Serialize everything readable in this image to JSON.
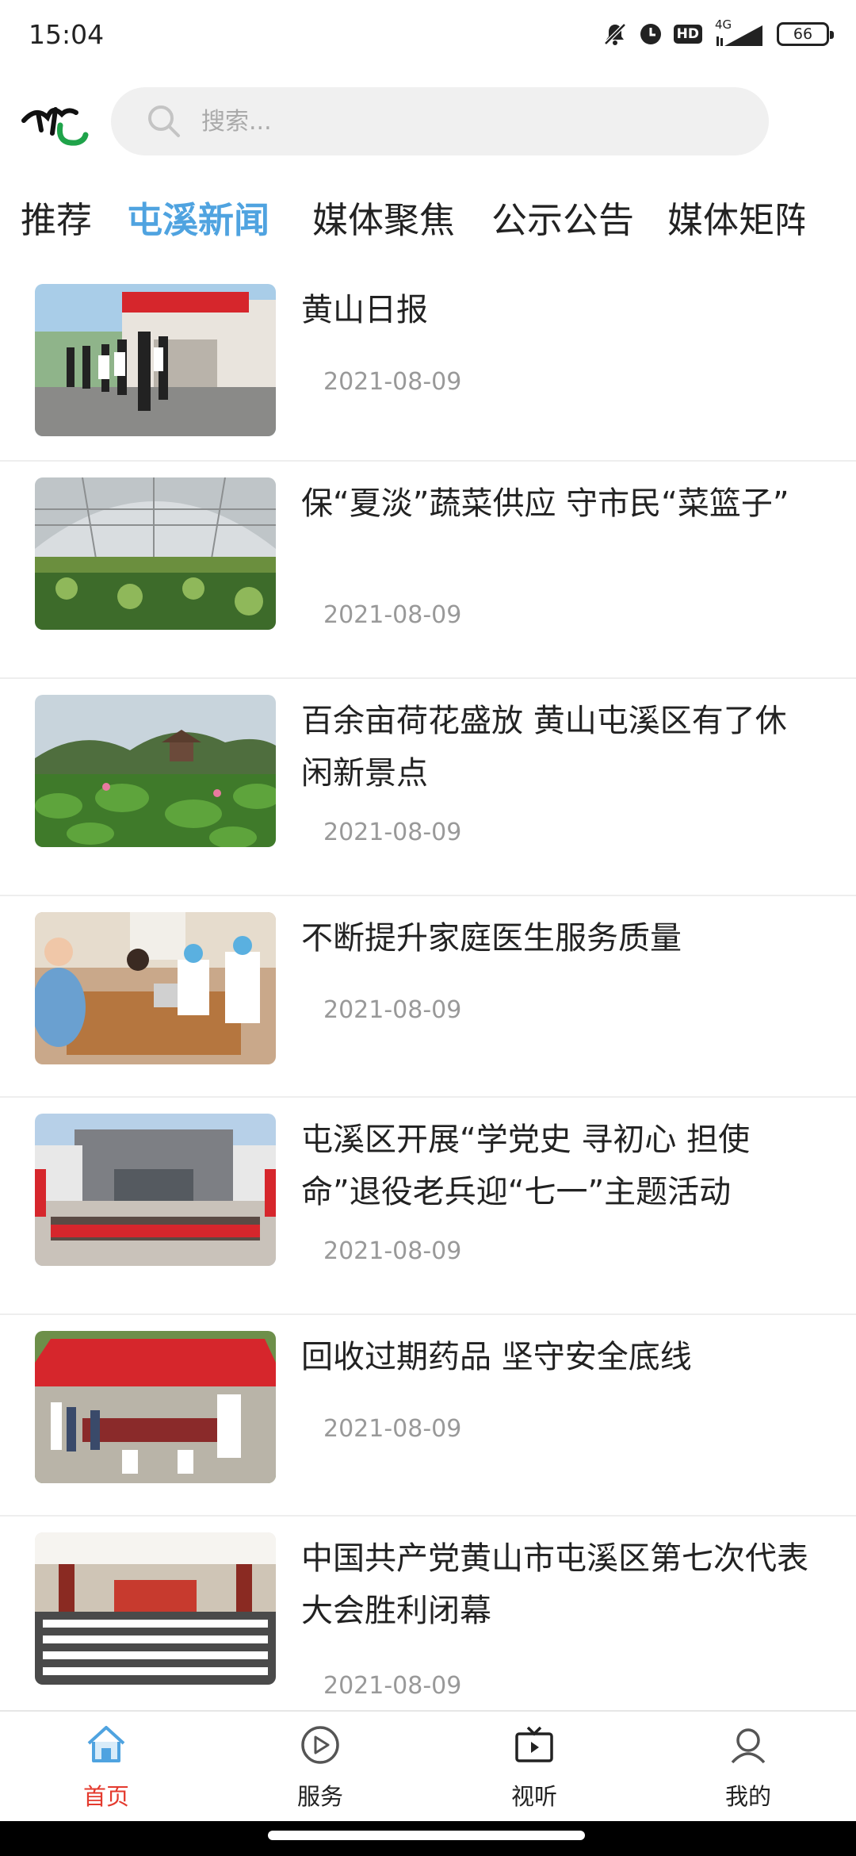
{
  "status_bar": {
    "time": "15:04",
    "network": "4G",
    "hd": "HD",
    "battery": "66"
  },
  "header": {
    "search_placeholder": "搜索..."
  },
  "tabs": [
    {
      "label": "推荐"
    },
    {
      "label": "屯溪新闻",
      "active": true
    },
    {
      "label": "媒体聚焦"
    },
    {
      "label": "公示公告"
    },
    {
      "label": "媒体矩阵"
    }
  ],
  "news": [
    {
      "title": "黄山日报",
      "date": "2021-08-09"
    },
    {
      "title": "保“夏淡”蔬菜供应 守市民“菜篮子”",
      "date": "2021-08-09"
    },
    {
      "title": "百余亩荷花盛放 黄山屯溪区有了休闲新景点",
      "date": "2021-08-09"
    },
    {
      "title": "不断提升家庭医生服务质量",
      "date": "2021-08-09"
    },
    {
      "title": "屯溪区开展“学党史 寻初心 担使命”退役老兵迎“七一”主题活动",
      "date": "2021-08-09"
    },
    {
      "title": "回收过期药品 坚守安全底线",
      "date": "2021-08-09"
    },
    {
      "title": "中国共产党黄山市屯溪区第七次代表大会胜利闭幕",
      "date": "2021-08-09"
    }
  ],
  "bottom_nav": [
    {
      "label": "首页",
      "icon": "home-icon",
      "active": true
    },
    {
      "label": "服务",
      "icon": "play-circle-icon"
    },
    {
      "label": "视听",
      "icon": "tv-icon"
    },
    {
      "label": "我的",
      "icon": "user-icon"
    }
  ],
  "colors": {
    "accent_blue": "#4fa3e0",
    "active_red": "#e43a2e"
  }
}
